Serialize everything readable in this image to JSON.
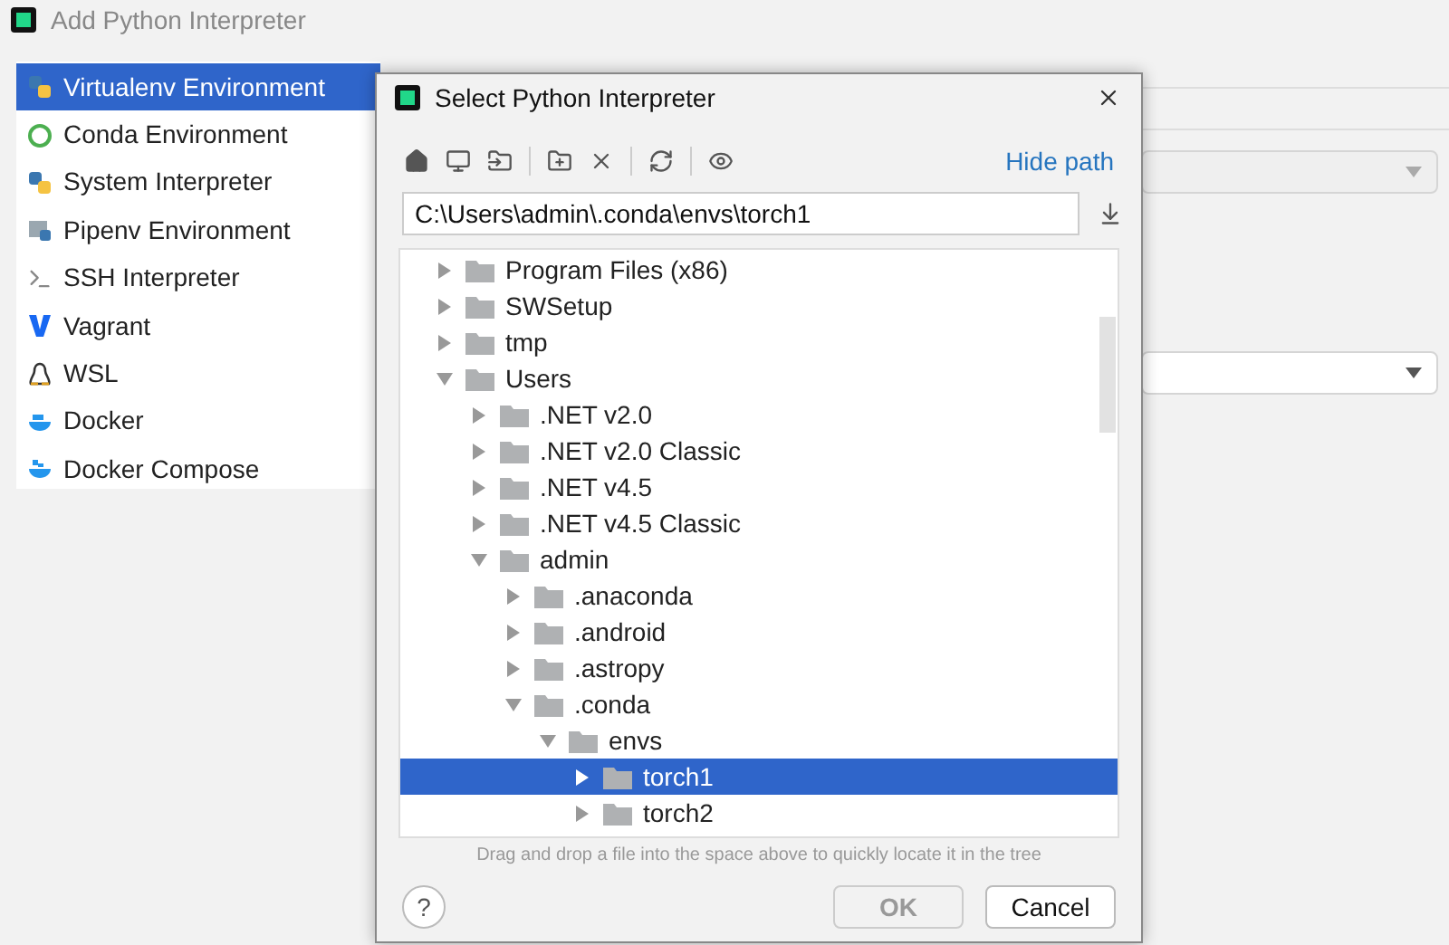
{
  "window": {
    "title": "Add Python Interpreter"
  },
  "sidebar": {
    "items": [
      {
        "label": "Virtualenv Environment",
        "selected": true
      },
      {
        "label": "Conda Environment",
        "selected": false
      },
      {
        "label": "System Interpreter",
        "selected": false
      },
      {
        "label": "Pipenv Environment",
        "selected": false
      },
      {
        "label": "SSH Interpreter",
        "selected": false
      },
      {
        "label": "Vagrant",
        "selected": false
      },
      {
        "label": "WSL",
        "selected": false
      },
      {
        "label": "Docker",
        "selected": false
      },
      {
        "label": "Docker Compose",
        "selected": false
      }
    ]
  },
  "settings_fields": [
    {
      "disabled": true
    },
    {
      "disabled": false
    }
  ],
  "dialog": {
    "title": "Select Python Interpreter",
    "hide_path_link": "Hide path",
    "path": "C:\\Users\\admin\\.conda\\envs\\torch1",
    "tree": [
      {
        "label": "Program Files (x86)",
        "expanded": false,
        "selected": false
      },
      {
        "label": "SWSetup",
        "expanded": false,
        "selected": false
      },
      {
        "label": "tmp",
        "expanded": false,
        "selected": false
      },
      {
        "label": "Users",
        "expanded": true,
        "selected": false,
        "children": [
          {
            "label": ".NET v2.0",
            "expanded": false,
            "selected": false
          },
          {
            "label": ".NET v2.0 Classic",
            "expanded": false,
            "selected": false
          },
          {
            "label": ".NET v4.5",
            "expanded": false,
            "selected": false
          },
          {
            "label": ".NET v4.5 Classic",
            "expanded": false,
            "selected": false
          },
          {
            "label": "admin",
            "expanded": true,
            "selected": false,
            "children": [
              {
                "label": ".anaconda",
                "expanded": false,
                "selected": false
              },
              {
                "label": ".android",
                "expanded": false,
                "selected": false
              },
              {
                "label": ".astropy",
                "expanded": false,
                "selected": false
              },
              {
                "label": ".conda",
                "expanded": true,
                "selected": false,
                "children": [
                  {
                    "label": "envs",
                    "expanded": true,
                    "selected": false,
                    "children": [
                      {
                        "label": "torch1",
                        "expanded": false,
                        "selected": true
                      },
                      {
                        "label": "torch2",
                        "expanded": false,
                        "selected": false
                      }
                    ]
                  }
                ]
              }
            ]
          }
        ]
      }
    ],
    "hint": "Drag and drop a file into the space above to quickly locate it in the tree",
    "help_button": "?",
    "ok_button": {
      "label": "OK",
      "disabled": true
    },
    "cancel_button": {
      "label": "Cancel"
    }
  }
}
